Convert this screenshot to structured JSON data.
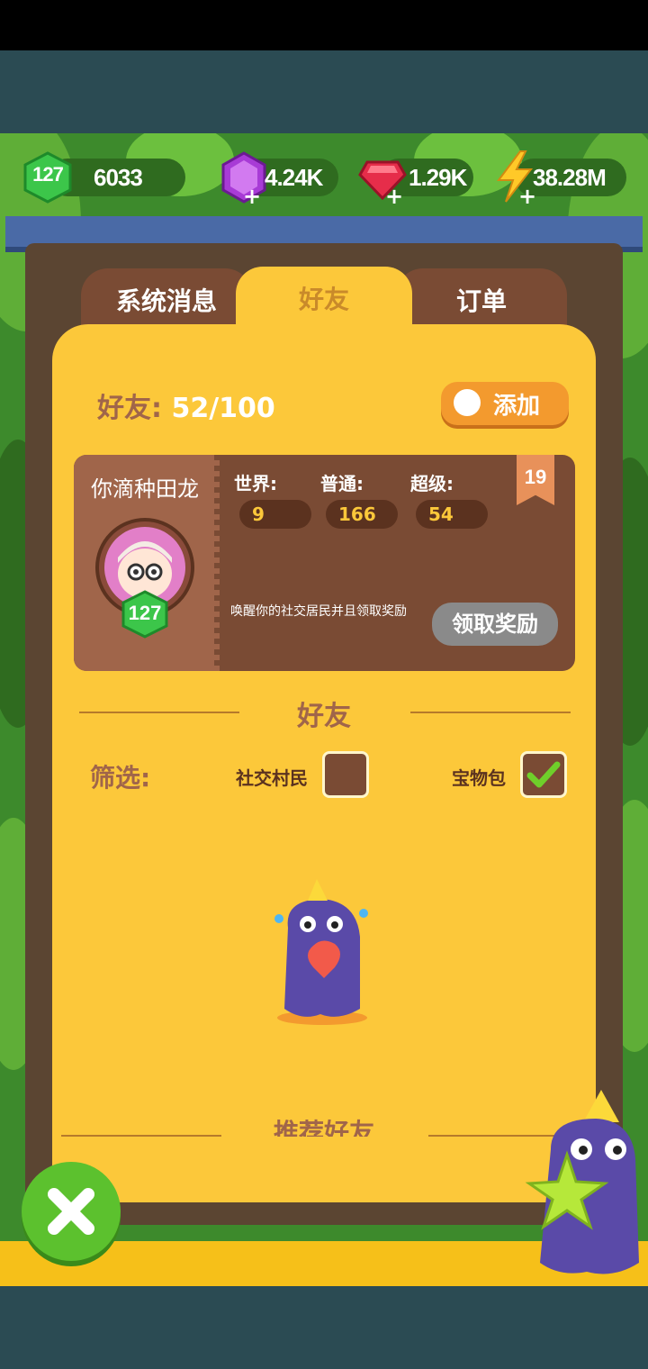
{
  "resources": {
    "level": "127",
    "xp": "6033",
    "gems_purple": "4.24K",
    "gems_red": "1.29K",
    "energy": "38.28M"
  },
  "tabs": [
    {
      "label": "系统消息",
      "active": false
    },
    {
      "label": "好友",
      "active": true
    },
    {
      "label": "订单",
      "active": false
    }
  ],
  "friends": {
    "count_label": "好友:",
    "count_value": "52/100",
    "add_button": "添加"
  },
  "profile": {
    "name": "你滴种田龙",
    "level": "127",
    "badge": "19",
    "stats": [
      {
        "label": "世界:",
        "value": "9"
      },
      {
        "label": "普通:",
        "value": "166"
      },
      {
        "label": "超级:",
        "value": "54"
      }
    ],
    "note": "唤醒你的社交居民并且领取奖励",
    "claim_button": "领取奖励"
  },
  "section_friends": "好友",
  "filter": {
    "label": "筛选:",
    "options": [
      {
        "label": "社交村民",
        "checked": false
      },
      {
        "label": "宝物包",
        "checked": true
      }
    ]
  },
  "section_recommended": "推荐好友",
  "colors": {
    "panel": "#fcc83a",
    "tab_inactive": "#7a4b34",
    "accent_orange": "#f39a2e",
    "check_green": "#6fcf2a"
  }
}
